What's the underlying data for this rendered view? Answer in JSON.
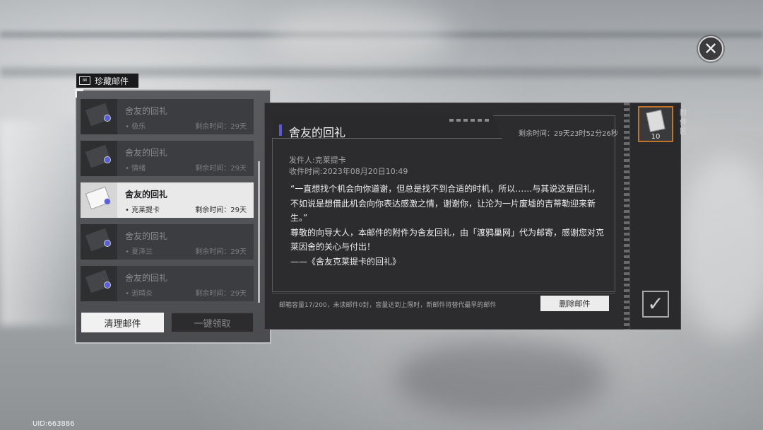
{
  "header": {
    "tab_label": "珍藏邮件"
  },
  "mail_list": [
    {
      "title": "舍友的回礼",
      "sender": "• 极乐",
      "remaining": "剩余时间：29天",
      "active": false
    },
    {
      "title": "舍友的回礼",
      "sender": "• 情绪",
      "remaining": "剩余时间：29天",
      "active": false
    },
    {
      "title": "舍友的回礼",
      "sender": "• 克莱提卡",
      "remaining": "剩余时间：29天",
      "active": true
    },
    {
      "title": "舍友的回礼",
      "sender": "• 夏泽兰",
      "remaining": "剩余时间：29天",
      "active": false
    },
    {
      "title": "舍友的回礼",
      "sender": "• 逝晴炎",
      "remaining": "剩余时间：29天",
      "active": false
    }
  ],
  "buttons": {
    "clean": "清理邮件",
    "claim_all": "一键领取",
    "delete": "删除邮件"
  },
  "detail": {
    "title": "舍友的回礼",
    "deadline": "剩余时间：29天23时52分26秒",
    "sender": "发件人:克莱提卡",
    "received": "收件时间:2023年08月20日10:49",
    "paragraphs": [
      "“一直想找个机会向你道谢，但总是找不到合适的时机，所以……与其说这是回礼，不如说是想借此机会向你表达感激之情，谢谢你，让沦为一片废墟的吉蒂勒迎来新生。”",
      "尊敬的向导大人，本邮件的附件为舍友回礼，由「渡鸦巢网」代为邮寄，感谢您对克莱因舍的关心与付出！",
      "——《舍友克莱提卡的回礼》"
    ],
    "capacity": "邮箱容量17/200，未读邮件0封，容量达到上限时，新邮件将替代最早的邮件"
  },
  "attachment": {
    "label": "附件区",
    "quantity": "10",
    "icon": "letter-icon"
  },
  "footer": {
    "uid": "UID:663886"
  },
  "icons": {
    "close": "close-icon",
    "confirm": "check-icon"
  },
  "colors": {
    "accent": "#5b5ad6",
    "attachment_border": "#c2742a"
  }
}
